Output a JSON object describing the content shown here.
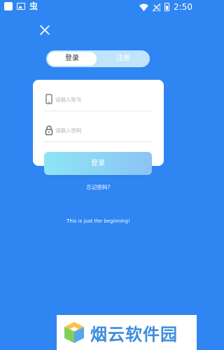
{
  "status_bar": {
    "time": "2:50",
    "bug_icon_glyph": "虫"
  },
  "tabs": [
    {
      "label": "登录",
      "active": true
    },
    {
      "label": "注册",
      "active": false
    }
  ],
  "form": {
    "account": {
      "placeholder": "请输入账号",
      "value": "",
      "icon": "phone-icon"
    },
    "password": {
      "placeholder": "请输入密码",
      "value": "",
      "icon": "lock-icon"
    }
  },
  "login_button_label": "登录",
  "forgot_password": "忘记密码?",
  "tagline": "This is just the beginning!",
  "watermark": {
    "text": "烟云软件园"
  },
  "colors": {
    "background": "#2f86f3",
    "card": "#ffffff",
    "button_start": "#8de5f5",
    "button_end": "#8cc3f5",
    "tab_track": "#bfe4fb"
  }
}
